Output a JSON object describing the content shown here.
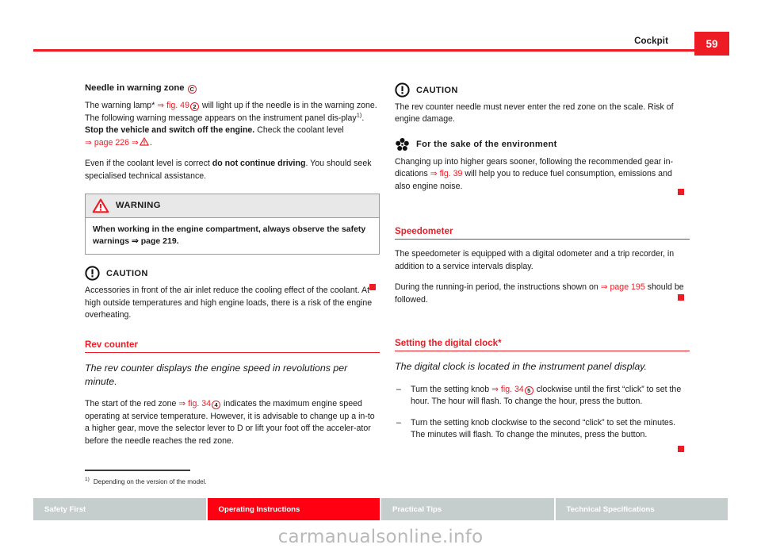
{
  "header": {
    "title": "Cockpit",
    "page_number": "59"
  },
  "left_column": {
    "needle_heading": "Needle in warning zone",
    "needle_marker": "C",
    "para1_pre": "The warning lamp* ",
    "para1_ref": "⇒ fig. 49",
    "para1_marker": "2",
    "para1_mid": " will light up if the needle is in the warning zone. The following warning message appears on the instrument panel dis-play",
    "para1_footnote": "1)",
    "para1_bold": "Stop the vehicle and switch off the engine.",
    "para1_tail": " Check the coolant level ",
    "para1_ref2": "⇒ page 226 ⇒",
    "para2_pre": "Even if the coolant level is correct ",
    "para2_bold": "do not continue driving",
    "para2_tail": ". You should seek specialised technical assistance.",
    "warning": {
      "label": "WARNING",
      "icon": "warning-triangle-icon",
      "text": "When working in the engine compartment, always observe the safety warnings ⇒ page 219."
    },
    "caution": {
      "label": "CAUTION",
      "icon": "caution-exclamation-icon",
      "text": "Accessories in front of the air inlet reduce the cooling effect of the coolant. At high outside temperatures and high engine loads, there is a risk of the engine overheating."
    },
    "rev_counter": {
      "title": "Rev counter",
      "lead": "The rev counter displays the engine speed in revolutions per minute.",
      "para_pre": "The start of the red zone ",
      "para_ref": "⇒ fig. 34",
      "para_marker": "4",
      "para_tail": " indicates the maximum engine speed operating at service temperature. However, it is advisable to change up a in-to a higher gear, move the selector lever to D or lift your foot off the acceler-ator before the needle reaches the red zone."
    }
  },
  "right_column": {
    "caution": {
      "label": "CAUTION",
      "icon": "caution-exclamation-icon",
      "text": "The rev counter needle must never enter the red zone on the scale. Risk of engine damage."
    },
    "environment": {
      "label": "For the sake of the environment",
      "icon": "flower-environment-icon",
      "text_pre": "Changing up into higher gears sooner, following the recommended gear in-dications ",
      "text_ref": "⇒ fig. 39",
      "text_tail": " will help you to reduce fuel consumption, emissions and also engine noise."
    },
    "speedometer": {
      "title": "Speedometer",
      "para1": "The speedometer is equipped with a digital odometer and a trip recorder, in addition to a service intervals display.",
      "para2_pre": "During the running-in period, the instructions shown on ",
      "para2_ref": "⇒ page 195",
      "para2_tail": " should be followed."
    },
    "digital_clock": {
      "title": "Setting the digital clock*",
      "lead": "The digital clock is located in the instrument panel display.",
      "item1_pre": "Turn the setting knob ",
      "item1_ref": "⇒ fig. 34",
      "item1_marker": "5",
      "item1_tail": " clockwise until the first “click” to set the hour. The hour will flash. To change the hour, press the button.",
      "item2": "Turn the setting knob clockwise to the second “click” to set the minutes. The minutes will flash. To change the minutes, press the button.",
      "dash": "–"
    }
  },
  "footnote": {
    "marker": "1)",
    "text": "Depending on the version of the model."
  },
  "footer": {
    "tabs": [
      {
        "label": "Safety First",
        "active": false
      },
      {
        "label": "Operating Instructions",
        "active": true
      },
      {
        "label": "Practical Tips",
        "active": false
      },
      {
        "label": "Technical Specifications",
        "active": false
      }
    ]
  },
  "watermark": "carmanualsonline.info",
  "colors": {
    "brand_red": "#ed1c24",
    "tab_red": "#ff0012",
    "tab_gray": "#c6cdcd"
  }
}
